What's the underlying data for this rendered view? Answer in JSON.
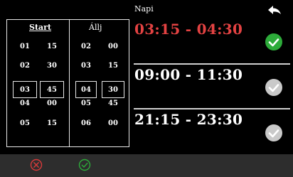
{
  "picker": {
    "start_label": "Start",
    "stop_label": "Állj",
    "start_rows": [
      {
        "h": "01",
        "m": "15"
      },
      {
        "h": "02",
        "m": "30"
      },
      {
        "h": "03",
        "m": "45"
      },
      {
        "h": "04",
        "m": "00"
      },
      {
        "h": "05",
        "m": "15"
      }
    ],
    "stop_rows": [
      {
        "h": "02",
        "m": "00"
      },
      {
        "h": "03",
        "m": "15"
      },
      {
        "h": "04",
        "m": "30"
      },
      {
        "h": "05",
        "m": "45"
      },
      {
        "h": "06",
        "m": "00"
      }
    ]
  },
  "header": {
    "mode_label": "Napi"
  },
  "schedules": [
    {
      "time": "03:15 - 04:30",
      "enabled": true
    },
    {
      "time": "09:00 - 11:30",
      "enabled": false
    },
    {
      "time": "21:15 - 23:30",
      "enabled": false
    }
  ],
  "colors": {
    "active_time": "#e34242",
    "check_on": "#2dab3a",
    "check_off": "#c9c9c9",
    "cancel": "#d93a3a",
    "confirm": "#2dab3a"
  },
  "icons": {
    "back": "back-arrow-icon",
    "check": "checkmark-icon",
    "cancel": "cancel-circle-icon",
    "confirm": "confirm-circle-icon"
  }
}
